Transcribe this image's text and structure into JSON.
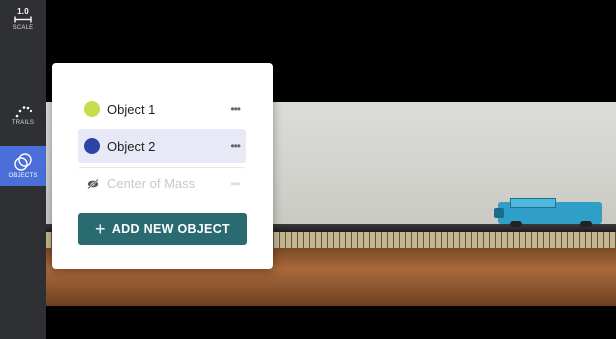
{
  "toolbar": {
    "scale": {
      "value": "1.0",
      "label": "SCALE"
    },
    "trails": {
      "label": "TRAILS"
    },
    "objects": {
      "label": "OBJECTS",
      "active": true
    }
  },
  "objects_panel": {
    "items": [
      {
        "name": "Object 1",
        "color": "#c9dc4b",
        "more": "•••",
        "selected": false
      },
      {
        "name": "Object 2",
        "color": "#2d43a8",
        "more": "•••",
        "selected": true
      },
      {
        "name": "Center of Mass",
        "icon": "eye-slash-icon",
        "more": "•••",
        "hidden": true
      }
    ],
    "add_button": {
      "icon": "+",
      "label": "ADD NEW OBJECT"
    }
  },
  "colors": {
    "sidebar_bg": "#2f3033",
    "active_tool": "#4a6fd8",
    "add_button_bg": "#2a6b72",
    "selected_row_bg": "#e7e9f7"
  }
}
